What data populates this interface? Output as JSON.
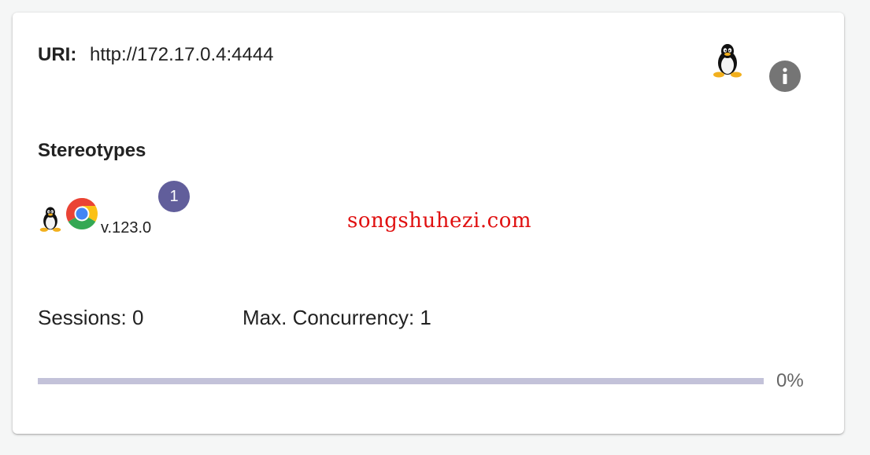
{
  "node": {
    "uri_label": "URI:",
    "uri_value": "http://172.17.0.4:4444",
    "os_icon": "linux-tux-icon",
    "info_icon": "info-icon"
  },
  "stereotypes": {
    "title": "Stereotypes",
    "items": [
      {
        "os_icon": "linux-tux-icon",
        "browser_icon": "chrome-icon",
        "version": "v.123.0",
        "slot_count": "1"
      }
    ]
  },
  "watermark": "songshuhezi.com",
  "stats": {
    "sessions": "Sessions: 0",
    "max_concurrency": "Max. Concurrency: 1"
  },
  "load": {
    "percent_label": "0%",
    "fraction": 0
  },
  "colors": {
    "badge": "#615e9b",
    "progress_track": "#c3c2d9",
    "info_button": "#757575",
    "watermark": "#e01010"
  }
}
